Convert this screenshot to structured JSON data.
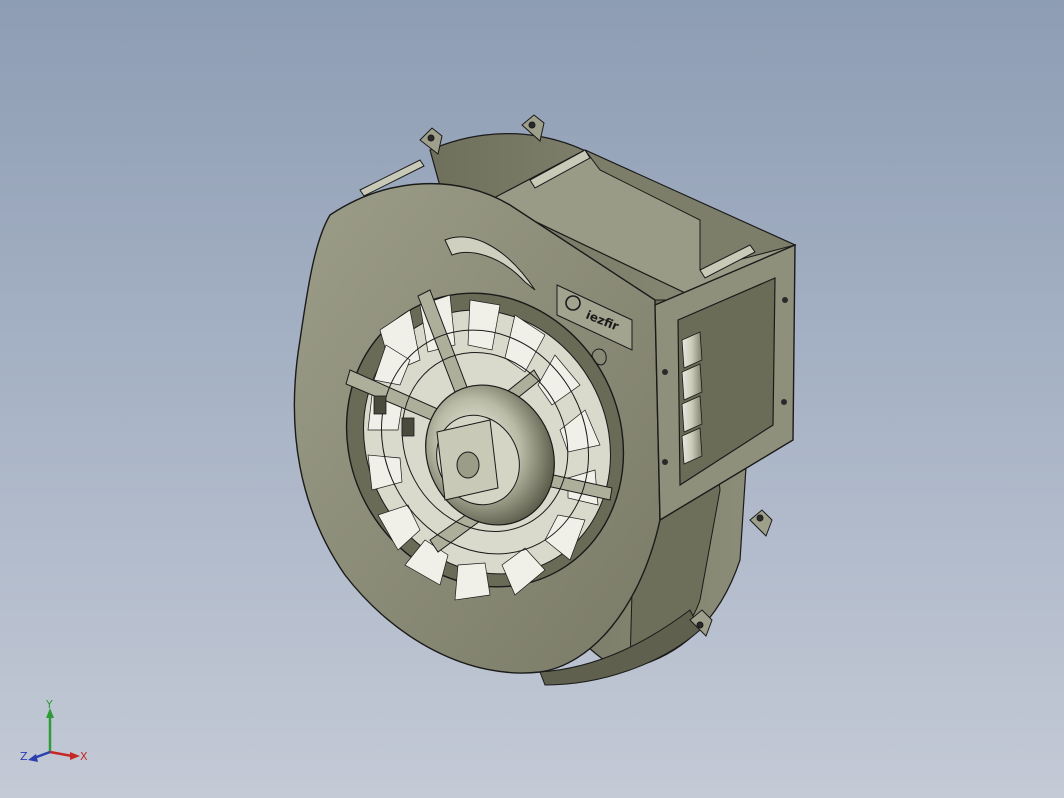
{
  "viewport": {
    "background_top": "#8e9db4",
    "background_bottom": "#c4cad6"
  },
  "model": {
    "part_color": "#8b8c78",
    "edge_color": "#1a1a1a",
    "logo_text": "iezfir",
    "logo_colors": [
      "#1a1a1a"
    ]
  },
  "triad": {
    "y_label": "Y",
    "x_label": "X",
    "z_label": "Z",
    "y_color": "#2e9a38",
    "x_color": "#c62828",
    "z_color": "#2b3fb0"
  }
}
